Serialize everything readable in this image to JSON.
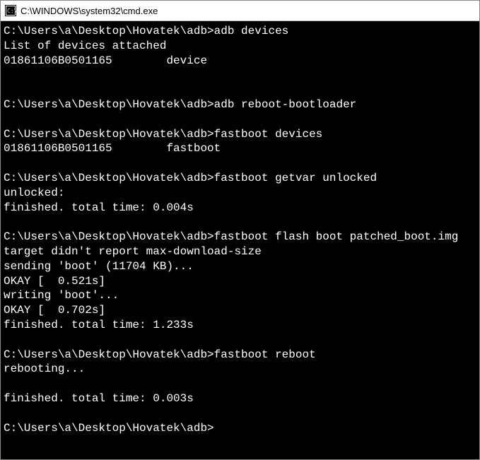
{
  "window": {
    "title": "C:\\WINDOWS\\system32\\cmd.exe"
  },
  "prompt": "C:\\Users\\a\\Desktop\\Hovatek\\adb>",
  "blocks": [
    {
      "command": "adb devices",
      "output": [
        "List of devices attached",
        "01861106B0501165        device",
        "",
        ""
      ]
    },
    {
      "command": "adb reboot-bootloader",
      "output": [
        ""
      ]
    },
    {
      "command": "fastboot devices",
      "output": [
        "01861106B0501165        fastboot",
        ""
      ]
    },
    {
      "command": "fastboot getvar unlocked",
      "output": [
        "unlocked:",
        "finished. total time: 0.004s",
        ""
      ]
    },
    {
      "command": "fastboot flash boot patched_boot.img",
      "output": [
        "target didn't report max-download-size",
        "sending 'boot' (11704 KB)...",
        "OKAY [  0.521s]",
        "writing 'boot'...",
        "OKAY [  0.702s]",
        "finished. total time: 1.233s",
        ""
      ]
    },
    {
      "command": "fastboot reboot",
      "output": [
        "rebooting...",
        "",
        "finished. total time: 0.003s",
        ""
      ]
    },
    {
      "command": "",
      "output": []
    }
  ]
}
